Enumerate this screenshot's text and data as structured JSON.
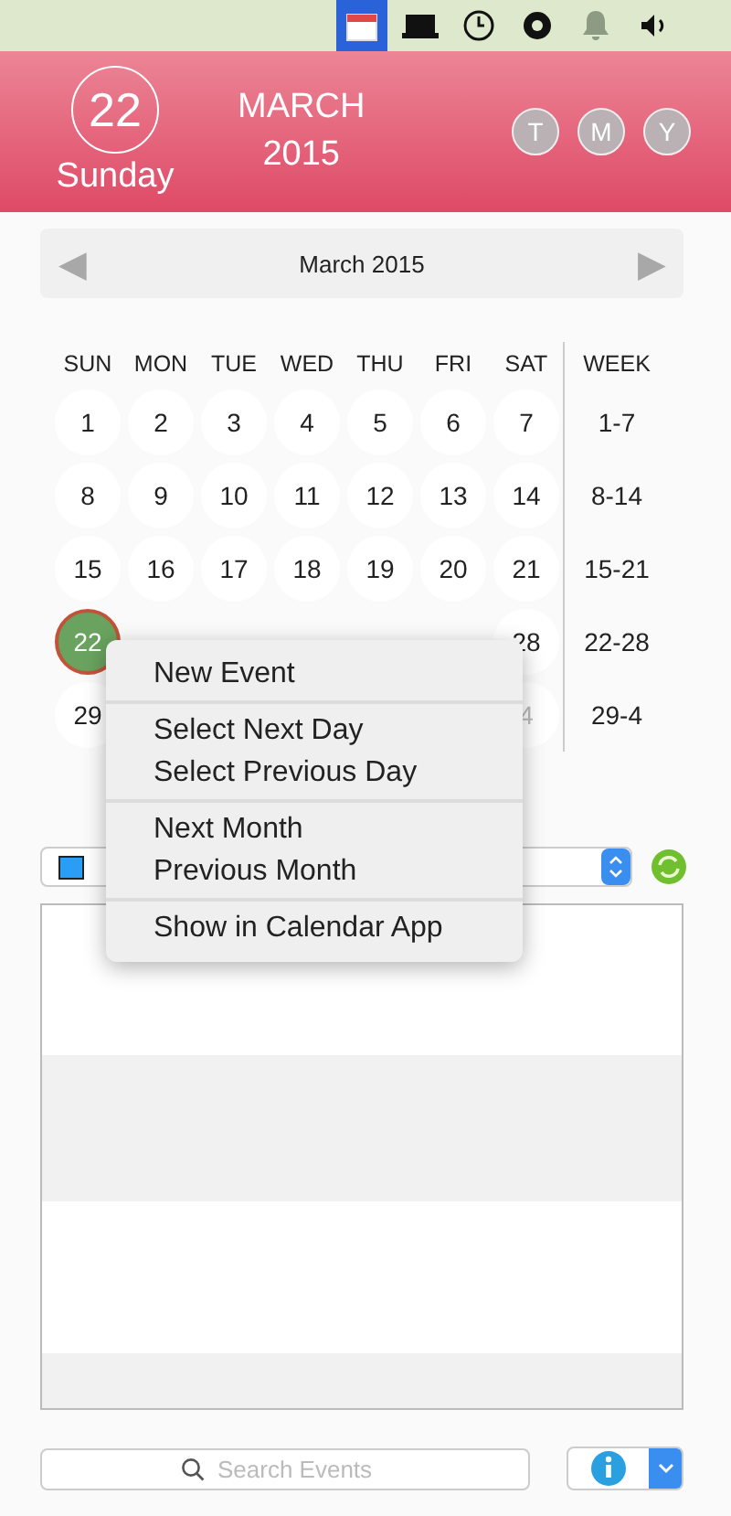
{
  "menu_bar": {
    "icons": [
      {
        "kind": "calendar",
        "selected": true
      },
      {
        "kind": "laptop",
        "selected": false
      },
      {
        "kind": "clock",
        "selected": false
      },
      {
        "kind": "ring",
        "selected": false
      },
      {
        "kind": "bell",
        "selected": false
      },
      {
        "kind": "speaker",
        "selected": false
      }
    ]
  },
  "header": {
    "day_number": "22",
    "weekday": "Sunday",
    "month": "MARCH",
    "year": "2015",
    "view_buttons": [
      {
        "label": "T"
      },
      {
        "label": "M"
      },
      {
        "label": "Y"
      }
    ]
  },
  "month_nav": {
    "prev": "◀",
    "title": "March 2015",
    "next": "▶"
  },
  "calendar": {
    "weekdays": [
      "SUN",
      "MON",
      "TUE",
      "WED",
      "THU",
      "FRI",
      "SAT"
    ],
    "week_heading": "WEEK",
    "weeks": [
      {
        "days": [
          {
            "label": "1",
            "selected": false,
            "other_month": false
          },
          {
            "label": "2",
            "selected": false,
            "other_month": false
          },
          {
            "label": "3",
            "selected": false,
            "other_month": false
          },
          {
            "label": "4",
            "selected": false,
            "other_month": false
          },
          {
            "label": "5",
            "selected": false,
            "other_month": false
          },
          {
            "label": "6",
            "selected": false,
            "other_month": false
          },
          {
            "label": "7",
            "selected": false,
            "other_month": false
          }
        ],
        "range": "1-7"
      },
      {
        "days": [
          {
            "label": "8",
            "selected": false,
            "other_month": false
          },
          {
            "label": "9",
            "selected": false,
            "other_month": false
          },
          {
            "label": "10",
            "selected": false,
            "other_month": false
          },
          {
            "label": "11",
            "selected": false,
            "other_month": false
          },
          {
            "label": "12",
            "selected": false,
            "other_month": false
          },
          {
            "label": "13",
            "selected": false,
            "other_month": false
          },
          {
            "label": "14",
            "selected": false,
            "other_month": false
          }
        ],
        "range": "8-14"
      },
      {
        "days": [
          {
            "label": "15",
            "selected": false,
            "other_month": false
          },
          {
            "label": "16",
            "selected": false,
            "other_month": false
          },
          {
            "label": "17",
            "selected": false,
            "other_month": false
          },
          {
            "label": "18",
            "selected": false,
            "other_month": false
          },
          {
            "label": "19",
            "selected": false,
            "other_month": false
          },
          {
            "label": "20",
            "selected": false,
            "other_month": false
          },
          {
            "label": "21",
            "selected": false,
            "other_month": false
          }
        ],
        "range": "15-21"
      },
      {
        "days": [
          {
            "label": "22",
            "selected": true,
            "other_month": false
          }
        ],
        "days_end": [
          {
            "label": "28",
            "selected": false,
            "other_month": false
          }
        ],
        "range": "22-28"
      },
      {
        "days": [
          {
            "label": "29",
            "selected": false,
            "other_month": false
          }
        ],
        "days_end": [
          {
            "label": "4",
            "selected": false,
            "other_month": true
          }
        ],
        "range": "29-4"
      }
    ]
  },
  "calendar_selector": {
    "color": "#2a9df4"
  },
  "context_menu": {
    "groups": [
      [
        "New Event"
      ],
      [
        "Select Next Day",
        "Select Previous Day"
      ],
      [
        "Next Month",
        "Previous Month"
      ],
      [
        "Show in Calendar App"
      ]
    ]
  },
  "search": {
    "placeholder": "Search Events"
  }
}
